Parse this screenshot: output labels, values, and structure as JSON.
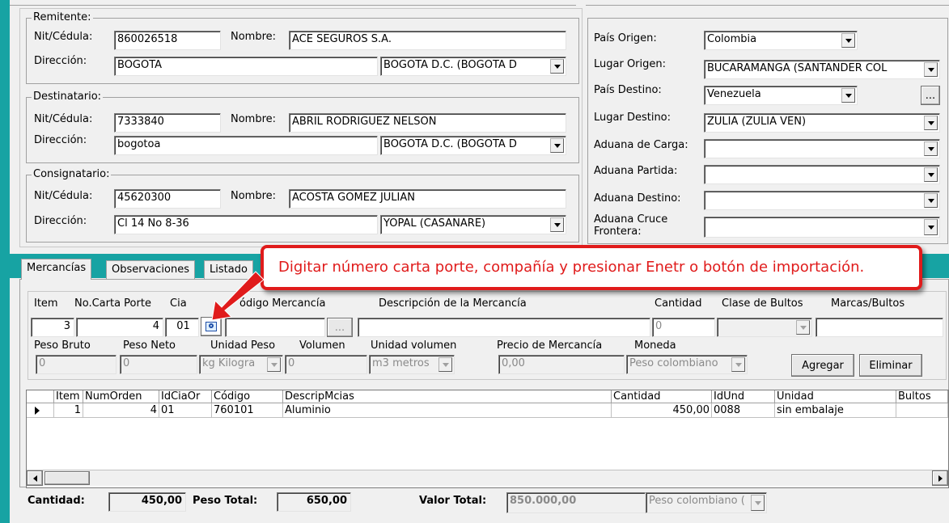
{
  "remitente": {
    "legend": "Remitente:",
    "nit_label": "Nit/Cédula:",
    "nit_value": "860026518",
    "nombre_label": "Nombre:",
    "nombre_value": "ACE SEGUROS S.A.",
    "direccion_label": "Dirección:",
    "direccion_value": "BOGOTA",
    "ciudad_value": "BOGOTA D.C.  (BOGOTA D"
  },
  "destinatario": {
    "legend": "Destinatario:",
    "nit_label": "Nit/Cédula:",
    "nit_value": "7333840",
    "nombre_label": "Nombre:",
    "nombre_value": "ABRIL RODRIGUEZ NELSON",
    "direccion_label": "Dirección:",
    "direccion_value": "bogotoa",
    "ciudad_value": "BOGOTA D.C.  (BOGOTA D"
  },
  "consignatario": {
    "legend": "Consignatario:",
    "nit_label": "Nit/Cédula:",
    "nit_value": "45620300",
    "nombre_label": "Nombre:",
    "nombre_value": "ACOSTA GOMEZ JULIAN",
    "direccion_label": "Dirección:",
    "direccion_value": "Cl 14 No 8-36",
    "ciudad_value": "YOPAL  (CASANARE)"
  },
  "ruta": {
    "pais_origen_label": "País Origen:",
    "pais_origen_value": "Colombia",
    "lugar_origen_label": "Lugar Origen:",
    "lugar_origen_value": "BUCARAMANGA (SANTANDER COL",
    "pais_destino_label": "País Destino:",
    "pais_destino_value": "Venezuela",
    "ellipsis": "...",
    "lugar_destino_label": "Lugar Destino:",
    "lugar_destino_value": "ZULIA (ZULIA VEN)",
    "aduana_carga_label": "Aduana de Carga:",
    "aduana_partida_label": "Aduana Partida:",
    "aduana_destino_label": "Aduana Destino:",
    "aduana_cruce_label_1": "Aduana Cruce",
    "aduana_cruce_label_2": "Frontera:"
  },
  "tabs": [
    "Mercancías",
    "Observaciones",
    "Listado"
  ],
  "callout": "Digitar número carta porte, compañía y presionar Enetr o botón de importación.",
  "mercancia_form": {
    "item_label": "Item",
    "carta_label": "No.Carta Porte",
    "cia_label": "Cia",
    "codigo_label": "ódigo Mercancía",
    "descripcion_label": "Descripción de la Mercancía",
    "cantidad_label": "Cantidad",
    "clase_label": "Clase de Bultos",
    "marcas_label": "Marcas/Bultos",
    "item_value": "3",
    "carta_value": "4",
    "cia_value": "01",
    "codigo_btn": "...",
    "cantidad_value": "0",
    "peso_bruto_label": "Peso Bruto",
    "peso_neto_label": "Peso Neto",
    "unidad_peso_label": "Unidad Peso",
    "volumen_label": "Volumen",
    "unidad_volumen_label": "Unidad volumen",
    "precio_label": "Precio de Mercancía",
    "moneda_label": "Moneda",
    "peso_bruto_value": "0",
    "peso_neto_value": "0",
    "unidad_peso_value": "kg  Kilogra",
    "volumen_value": "0",
    "unidad_volumen_value": "m3  metros",
    "precio_value": "0,00",
    "moneda_value": "Peso colombiano",
    "agregar_label": "Agregar",
    "eliminar_label": "Eliminar"
  },
  "grid": {
    "headers": [
      "Item",
      "NumOrden",
      "IdCiaOr",
      "Código",
      "DescripMcias",
      "Cantidad",
      "IdUnd",
      "Unidad",
      "Bultos"
    ],
    "rows": [
      {
        "item": "1",
        "numorden": "4",
        "idcia": "01",
        "codigo": "760101",
        "descrip": "Aluminio",
        "cantidad": "450,00",
        "idund": "0088",
        "unidad": "sin embalaje",
        "bultos": ""
      }
    ]
  },
  "totals": {
    "cantidad_label": "Cantidad:",
    "cantidad_value": "450,00",
    "peso_label": "Peso Total:",
    "peso_value": "650,00",
    "valor_label": "Valor Total:",
    "valor_value": "850.000,00",
    "moneda_value": "Peso colombiano ("
  },
  "colors": {
    "callout_red": "#e01b1b",
    "accent_teal": "#17a3a3",
    "window_bg": "#f0f0f0"
  }
}
